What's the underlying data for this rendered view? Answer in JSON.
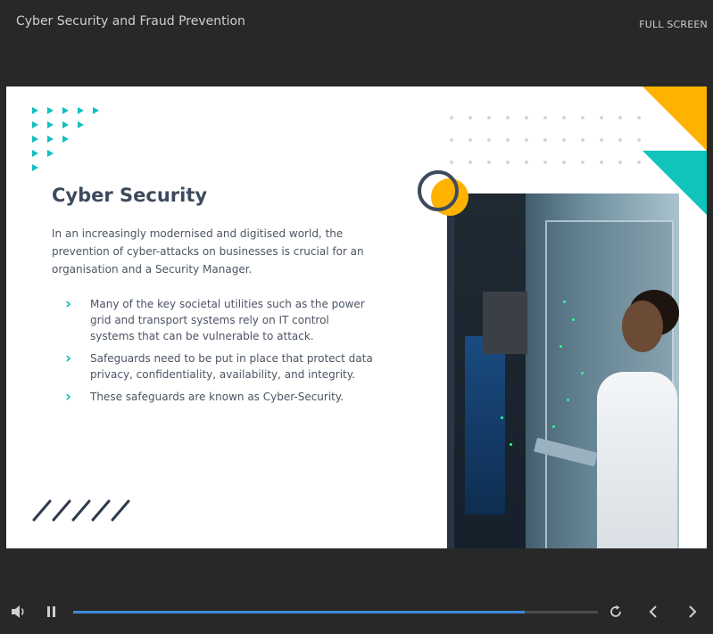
{
  "header": {
    "course_title": "Cyber Security and Fraud Prevention",
    "fullscreen_label": "FULL SCREEN"
  },
  "slide": {
    "heading": "Cyber Security",
    "intro": "In an increasingly modernised and digitised world, the prevention of cyber-attacks on businesses is crucial for an organisation and a Security Manager.",
    "bullets": [
      "Many of the key societal utilities such as the power grid and transport systems rely on IT control systems that can be vulnerable to attack.",
      "Safeguards need to be put in place that protect data privacy, confidentiality, availability, and integrity.",
      "These safeguards are known as Cyber-Security."
    ],
    "bullet_icon": "chevron-right-icon",
    "image": "data-center-technician-photo",
    "colors": {
      "heading": "#3d4a5d",
      "accent_teal": "#12bfbf",
      "accent_yellow": "#ffb300"
    }
  },
  "player": {
    "progress_fraction": 0.86,
    "progress_color": "#3f88d6",
    "icons": {
      "volume": "volume-icon",
      "pause": "pause-icon",
      "replay": "replay-icon",
      "previous": "chevron-left-icon",
      "next": "chevron-right-icon"
    }
  }
}
